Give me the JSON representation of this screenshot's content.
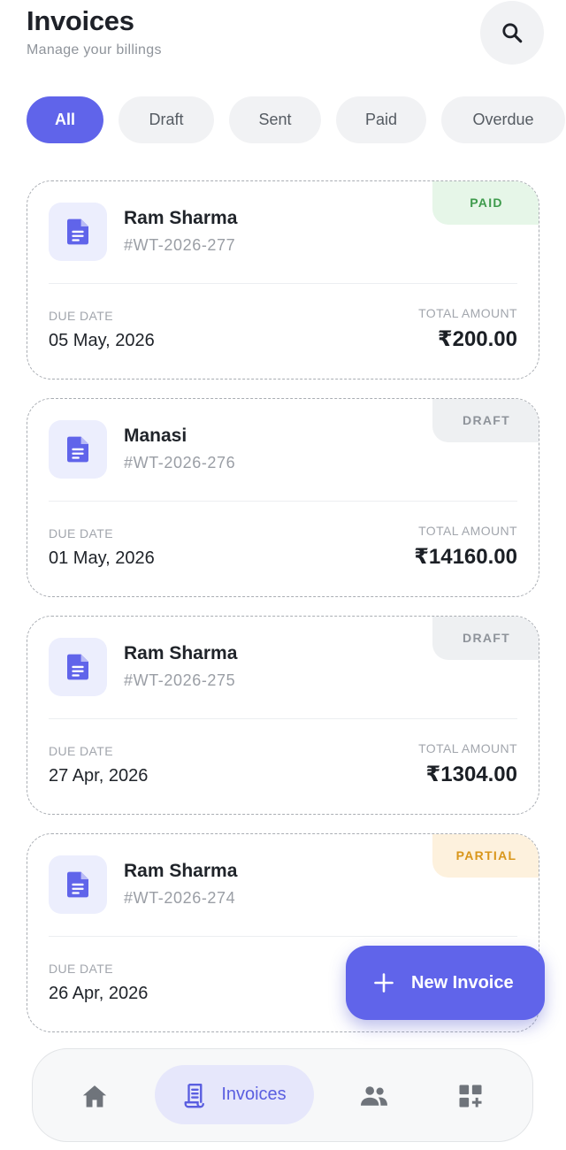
{
  "header": {
    "title": "Invoices",
    "subtitle": "Manage your billings"
  },
  "filters": [
    "All",
    "Draft",
    "Sent",
    "Paid",
    "Overdue"
  ],
  "labels": {
    "due_date": "DUE DATE",
    "total_amount": "TOTAL AMOUNT"
  },
  "invoices": [
    {
      "client": "Ram Sharma",
      "id": "#WT-2026-277",
      "status": "PAID",
      "due_date": "05 May, 2026",
      "amount": "₹200.00"
    },
    {
      "client": "Manasi",
      "id": "#WT-2026-276",
      "status": "DRAFT",
      "due_date": "01 May, 2026",
      "amount": "₹14160.00"
    },
    {
      "client": "Ram Sharma",
      "id": "#WT-2026-275",
      "status": "DRAFT",
      "due_date": "27 Apr, 2026",
      "amount": "₹1304.00"
    },
    {
      "client": "Ram Sharma",
      "id": "#WT-2026-274",
      "status": "PARTIAL",
      "due_date": "26 Apr, 2026",
      "amount": ""
    }
  ],
  "fab": {
    "label": "New Invoice"
  },
  "nav": {
    "active_label": "Invoices"
  },
  "colors": {
    "accent": "#6064ea",
    "paid_bg": "#e6f6e8",
    "paid_text": "#3e9b4c",
    "draft_bg": "#eef0f2",
    "draft_text": "#8e939a",
    "partial_bg": "#fdf1dd",
    "partial_text": "#d9961a"
  }
}
